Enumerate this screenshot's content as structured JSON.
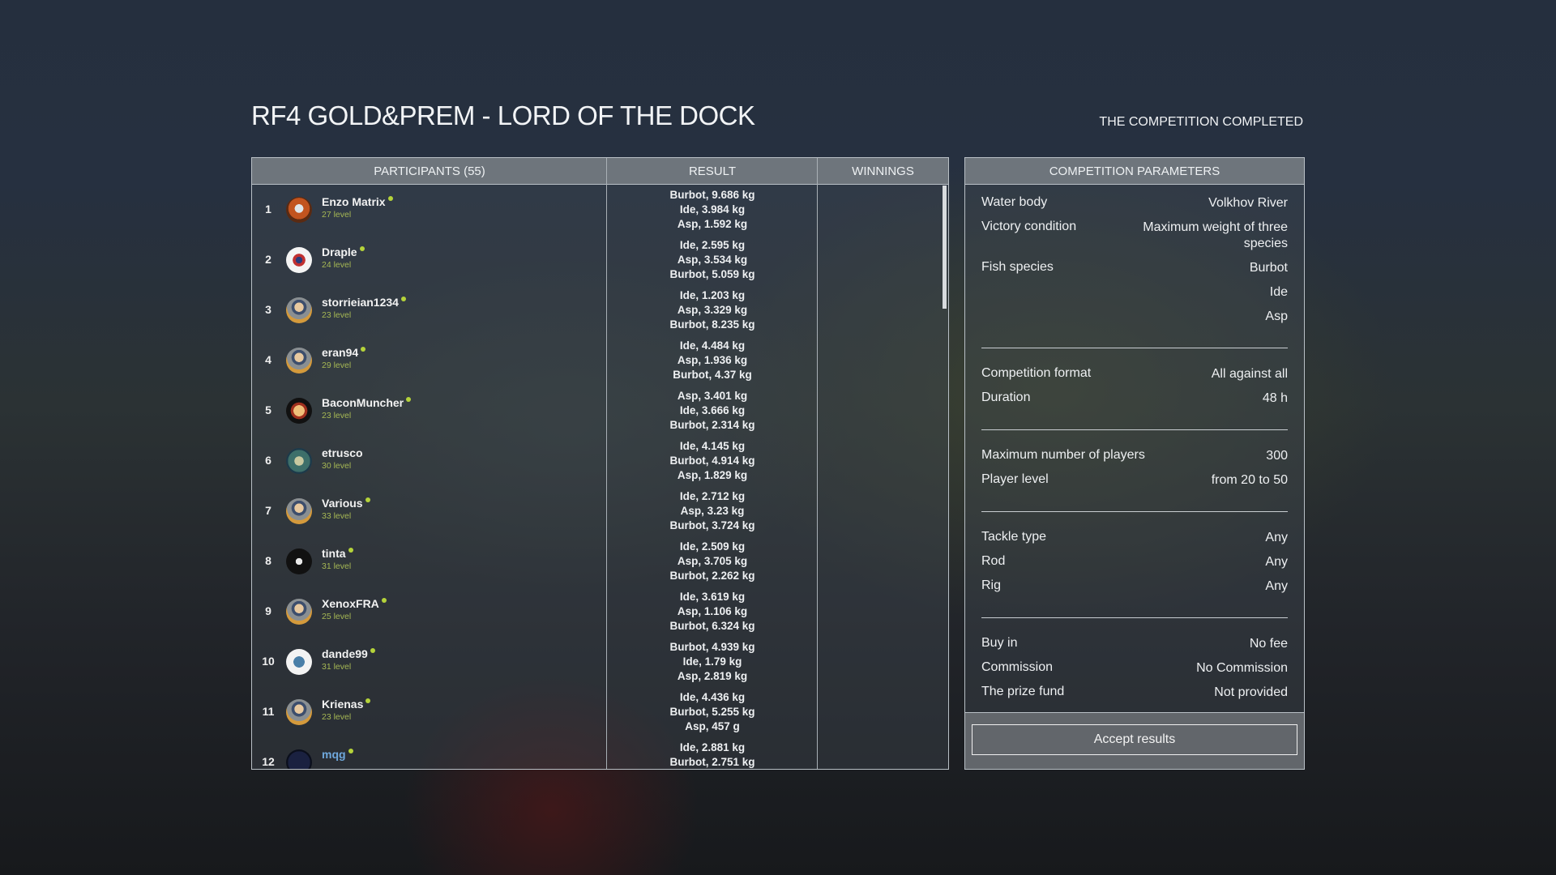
{
  "header": {
    "title": "RF4 GOLD&PREM - LORD OF THE DOCK",
    "status": "THE COMPETITION COMPLETED"
  },
  "table": {
    "columns": {
      "participants": "PARTICIPANTS (55)",
      "result": "RESULT",
      "winnings": "WINNINGS"
    },
    "rows": [
      {
        "rank": "1",
        "name": "Enzo Matrix",
        "level": "27 level",
        "online": true,
        "avatar": "fish-sunset",
        "results": [
          "Burbot, 9.686 kg",
          "Ide, 3.984 kg",
          "Asp, 1.592 kg"
        ]
      },
      {
        "rank": "2",
        "name": "Draple",
        "level": "24 level",
        "online": true,
        "avatar": "emblem-white",
        "results": [
          "Ide, 2.595 kg",
          "Asp, 3.534 kg",
          "Burbot, 5.059 kg"
        ]
      },
      {
        "rank": "3",
        "name": "storrieian1234",
        "level": "23 level",
        "online": true,
        "avatar": "default-fisherman",
        "results": [
          "Ide, 1.203 kg",
          "Asp, 3.329 kg",
          "Burbot, 8.235 kg"
        ]
      },
      {
        "rank": "4",
        "name": "eran94",
        "level": "29 level",
        "online": true,
        "avatar": "default-fisherman",
        "results": [
          "Ide, 4.484 kg",
          "Asp, 1.936 kg",
          "Burbot, 4.37 kg"
        ]
      },
      {
        "rank": "5",
        "name": "BaconMuncher",
        "level": "23 level",
        "online": true,
        "avatar": "fist-bacon",
        "results": [
          "Asp, 3.401 kg",
          "Ide, 3.666 kg",
          "Burbot, 2.314 kg"
        ]
      },
      {
        "rank": "6",
        "name": "etrusco",
        "level": "30 level",
        "online": false,
        "avatar": "fish-photo",
        "results": [
          "Ide, 4.145 kg",
          "Burbot, 4.914 kg",
          "Asp, 1.829 kg"
        ]
      },
      {
        "rank": "7",
        "name": "Various",
        "level": "33 level",
        "online": true,
        "avatar": "default-fisherman",
        "results": [
          "Ide, 2.712 kg",
          "Asp, 3.23 kg",
          "Burbot, 3.724 kg"
        ]
      },
      {
        "rank": "8",
        "name": "tinta",
        "level": "31 level",
        "online": true,
        "avatar": "black-emblem",
        "results": [
          "Ide, 2.509 kg",
          "Asp, 3.705 kg",
          "Burbot, 2.262 kg"
        ]
      },
      {
        "rank": "9",
        "name": "XenoxFRA",
        "level": "25 level",
        "online": true,
        "avatar": "default-fisherman",
        "results": [
          "Ide, 3.619 kg",
          "Asp, 1.106 kg",
          "Burbot, 6.324 kg"
        ]
      },
      {
        "rank": "10",
        "name": "dande99",
        "level": "31 level",
        "online": true,
        "avatar": "white-pattern",
        "results": [
          "Burbot, 4.939 kg",
          "Ide, 1.79 kg",
          "Asp, 2.819 kg"
        ]
      },
      {
        "rank": "11",
        "name": "Krienas",
        "level": "23 level",
        "online": true,
        "avatar": "default-fisherman",
        "results": [
          "Ide, 4.436 kg",
          "Burbot, 5.255 kg",
          "Asp, 457 g"
        ]
      },
      {
        "rank": "12",
        "name": "mqg",
        "level": "",
        "online": true,
        "avatar": "bream-logo",
        "highlight": true,
        "results": [
          "Ide, 2.881 kg",
          "Burbot, 2.751 kg"
        ]
      }
    ]
  },
  "params": {
    "title": "COMPETITION PARAMETERS",
    "groups": [
      [
        {
          "label": "Water body",
          "value": "Volkhov River"
        },
        {
          "label": "Victory condition",
          "value": "Maximum weight of three species"
        },
        {
          "label": "Fish species",
          "value": "Burbot"
        },
        {
          "label": "",
          "value": "Ide"
        },
        {
          "label": "",
          "value": "Asp"
        }
      ],
      [
        {
          "label": "Competition format",
          "value": "All against all"
        },
        {
          "label": "Duration",
          "value": "48 h"
        }
      ],
      [
        {
          "label": "Maximum number of players",
          "value": "300"
        },
        {
          "label": "Player level",
          "value": "from 20 to 50"
        }
      ],
      [
        {
          "label": "Tackle type",
          "value": "Any"
        },
        {
          "label": "Rod",
          "value": "Any"
        },
        {
          "label": "Rig",
          "value": "Any"
        }
      ],
      [
        {
          "label": "Buy in",
          "value": "No fee"
        },
        {
          "label": "Commission",
          "value": "No Commission"
        },
        {
          "label": "The prize fund",
          "value": "Not provided"
        }
      ]
    ],
    "accept_label": "Accept results"
  },
  "colors": {
    "online_dot": "#b5d33a",
    "level_text": "#a6b854",
    "highlight_name": "#6fa8dc",
    "header_bg": "#6e757c"
  }
}
